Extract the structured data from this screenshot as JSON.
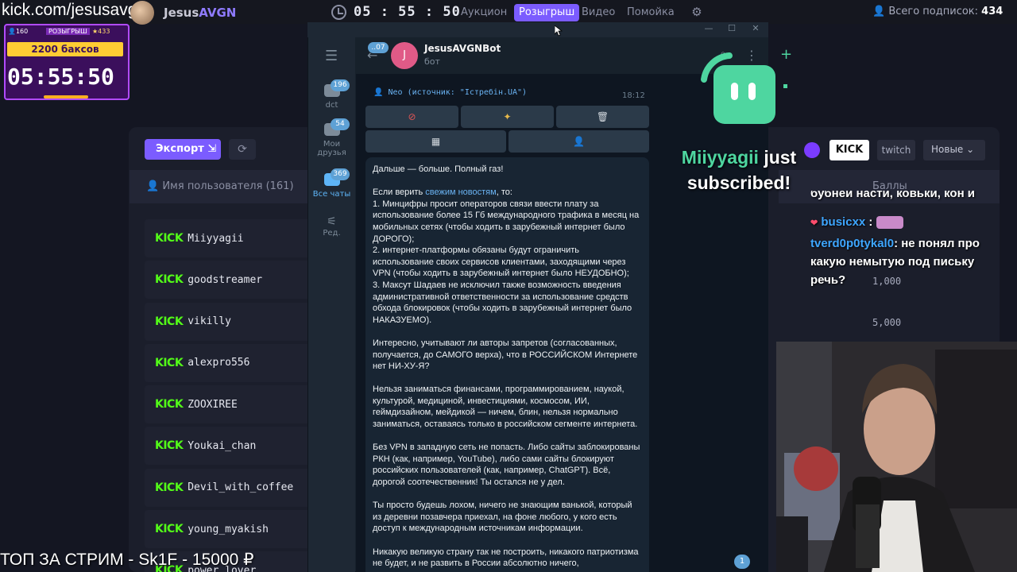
{
  "stream": {
    "url": "kick.com/jesusavgn",
    "top_donor": "ТОП ЗА СТРИМ - Sk1F - 15000 ₽"
  },
  "topbar": {
    "brand_pre": "Jesus",
    "brand_hl": "AVGN",
    "timer": "05 : 55 : 50",
    "tabs": [
      "Аукцион",
      "Розыгрыш",
      "Видео",
      "Помойка"
    ],
    "active_tab": "Розыгрыш",
    "subs_label": "Всего подписок:",
    "subs_count": "434"
  },
  "raffle_widget": {
    "left_count": "160",
    "label": "РОЗЫГРЫШ",
    "right_count": "433",
    "prize": "2200 баксов",
    "timer": "05:55:50"
  },
  "background_app": {
    "export_label": "Экспорт",
    "column_user": "Имя пользователя (161)",
    "column_score": "Баллы",
    "filters": {
      "kick": "KICK",
      "twitch": "twitch",
      "sort": "Новые"
    },
    "users": [
      {
        "platform": "KICK",
        "name": "Miiyyagii"
      },
      {
        "platform": "KICK",
        "name": "goodstreamer"
      },
      {
        "platform": "KICK",
        "name": "vikilly"
      },
      {
        "platform": "KICK",
        "name": "alexpro556"
      },
      {
        "platform": "KICK",
        "name": "ZOOXIREE"
      },
      {
        "platform": "KICK",
        "name": "Youkai_chan"
      },
      {
        "platform": "KICK",
        "name": "Devil_with_coffee"
      },
      {
        "platform": "KICK",
        "name": "young_myakish"
      },
      {
        "platform": "KICK",
        "name": "power_lover"
      }
    ],
    "scores": [
      "1,000",
      "5,000"
    ]
  },
  "telegram": {
    "folders": [
      {
        "label": "dct",
        "badge": "196"
      },
      {
        "label": "Мои друзья",
        "badge": "54"
      },
      {
        "label": "Все чаты",
        "badge": "369"
      },
      {
        "label": "Ред.",
        "badge": ""
      }
    ],
    "back_badge": "..07",
    "chat_name": "JesusAVGNBot",
    "chat_status": "бот",
    "avatar_letter": "J",
    "forward_line": "Neo (источник: \"Істребін.UA\")",
    "msg_time": "18:12",
    "unread": "1",
    "message": {
      "p1": "Дальше — больше. Полный газ!",
      "p2_pre": "Если верить ",
      "p2_link": "свежим новостям",
      "p2_post": ", то:",
      "p2_items": [
        "1. Минцифры просит операторов связи ввести плату за использование более 15 Гб международного трафика в месяц на мобильных сетях (чтобы ходить в зарубежный интернет было ДОРОГО);",
        "2. интернет-платформы обязаны будут ограничить использование своих сервисов клиентами, заходящими через VPN (чтобы ходить в зарубежный интернет было НЕУДОБНО);",
        "3. Максут Шадаев не исключил также возможность введения административной ответственности за использование средств обхода блокировок (чтобы ходить в зарубежный интернет было НАКАЗУЕМО)."
      ],
      "p3": "Интересно, учитывают ли авторы запретов (согласованных, получается, до САМОГО верха), что в РОССИЙСКОМ Интернете нет НИ-ХУ-Я?",
      "p4": "Нельзя заниматься финансами, программированием, наукой, культурой, медициной, инвестициями, космосом, ИИ, геймдизайном, мейдикой — ничем, блин, нельзя нормально заниматься, оставаясь только в российском сегменте интернета.",
      "p5": "Без VPN в западную сеть не попасть. Либо сайты заблокированы РКН (как, например, YouTube), либо сами сайты блокируют российских пользователей (как, например, ChatGPT). Всё, дорогой соотечественник! Ты остался не у дел.",
      "p6": "Ты просто будешь лохом, ничего не знающим ванькой, который из деревни позавчера приехал, на фоне любого, у кого есть доступ к международным источникам информации.",
      "p7": "Никакую великую страну так не построить, никакого патриотизма не будет, и не развить в России абсолютно ничего,"
    }
  },
  "sub_alert": {
    "name": "Miiyyagii",
    "text1": " just",
    "text2": "subscribed!"
  },
  "chat_overlay": {
    "line0": "бубней насти, ковьки, кон и",
    "user1": "busicxx",
    "user2": "tverd0p0tykal0",
    "msg2": ": не понял про какую немытую под письку речь?"
  },
  "colors": {
    "accent": "#7b5cff",
    "kick": "#53fc18",
    "telegram_bg": "#0e1621",
    "alert_green": "#4ed6a0"
  }
}
